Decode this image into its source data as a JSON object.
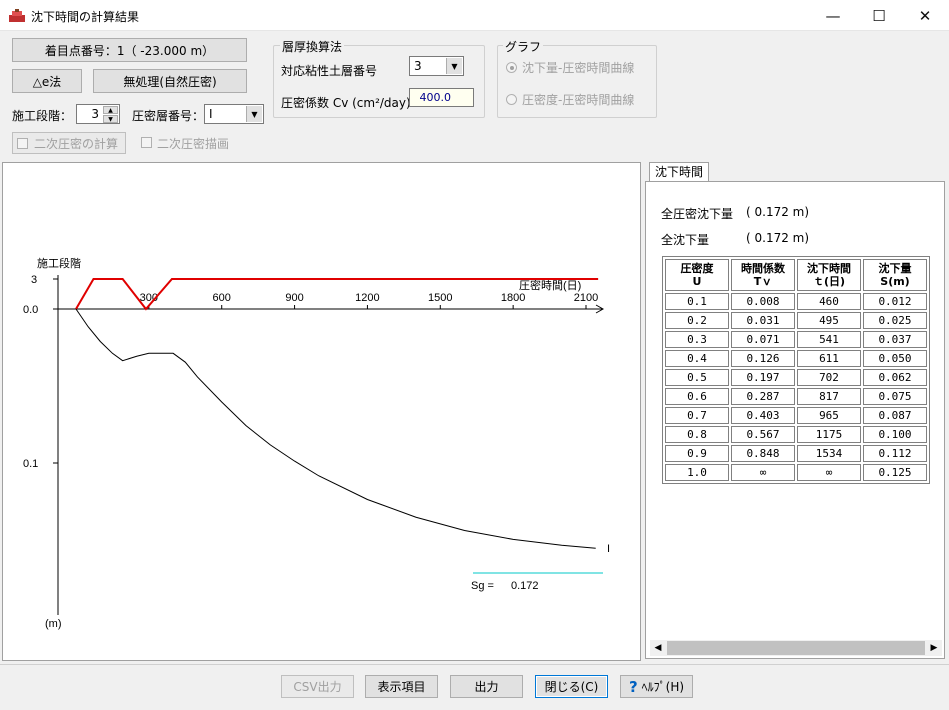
{
  "window": {
    "title": "沈下時間の計算結果",
    "minimize_glyph": "—",
    "maximize_glyph": "☐",
    "close_glyph": "✕"
  },
  "top_controls": {
    "point_button": "着目点番号：1（ -23.000 m）",
    "delta_e_button": "△e法",
    "no_treatment_button": "無処理(自然圧密)",
    "construction_stage_label": "施工段階：",
    "construction_stage_value": "3",
    "consolidation_layer_label": "圧密層番号：",
    "consolidation_layer_value": "I",
    "secondary_calc_button": "二次圧密の計算",
    "secondary_draw_label": "二次圧密描画"
  },
  "layer_group": {
    "title": "層厚換算法",
    "clay_layer_label": "対応粘性土層番号",
    "clay_layer_value": "3",
    "cv_label": "圧密係数 Cv (cm²/day)",
    "cv_value": "400.0"
  },
  "graph_group": {
    "title": "グラフ",
    "option1": "沈下量-圧密時間曲線",
    "option2": "圧密度-圧密時間曲線",
    "selected": "option1"
  },
  "graph": {
    "stage_axis_label": "施工段階",
    "stage_tick": "3",
    "x_axis_label": "圧密時間(日)",
    "x_ticks": [
      "300",
      "600",
      "900",
      "1200",
      "1500",
      "1800",
      "2100"
    ],
    "y_ticks": [
      "0.0",
      "0.1"
    ],
    "y_unit": "(m)",
    "curve_label": "I",
    "sg_label": "Sg =",
    "sg_value": "0.172",
    "stage_color": "#e00000",
    "curve_color": "#000000",
    "final_color": "#00c8c8"
  },
  "chart_data": {
    "type": "line",
    "title": "",
    "xlabel": "圧密時間(日)",
    "ylabel": "(m)",
    "xlim": [
      0,
      2150
    ],
    "ylim_settlement": [
      0,
      0.2
    ],
    "settlement_series": {
      "name": "I",
      "x": [
        0,
        50,
        100,
        150,
        192,
        250,
        300,
        350,
        400,
        450,
        500,
        600,
        700,
        800,
        900,
        1000,
        1200,
        1400,
        1600,
        1800,
        2000,
        2140
      ],
      "y": [
        0.0,
        0.012,
        0.022,
        0.03,
        0.035,
        0.032,
        0.03,
        0.03,
        0.03,
        0.036,
        0.046,
        0.063,
        0.079,
        0.092,
        0.103,
        0.113,
        0.129,
        0.141,
        0.15,
        0.156,
        0.16,
        0.162
      ]
    },
    "construction_stage_series": {
      "x": [
        0,
        72,
        192,
        288,
        395,
        2150
      ],
      "y": [
        0,
        1,
        1,
        0,
        1,
        1
      ],
      "x_detail": [
        0,
        72,
        192,
        288,
        395,
        2150
      ]
    },
    "final_settlement": 0.172
  },
  "tab": {
    "label": "沈下時間"
  },
  "summary": {
    "total_consolidation_label": "全圧密沈下量",
    "total_consolidation_value": "( 0.172 m)",
    "total_settlement_label": "全沈下量",
    "total_settlement_value": "( 0.172 m)"
  },
  "table": {
    "headers": [
      [
        "圧密度",
        "U"
      ],
      [
        "時間係数",
        "Tｖ"
      ],
      [
        "沈下時間",
        "ｔ(日)"
      ],
      [
        "沈下量",
        "S(m)"
      ]
    ],
    "rows": [
      [
        "0.1",
        "0.008",
        "460",
        "0.012"
      ],
      [
        "0.2",
        "0.031",
        "495",
        "0.025"
      ],
      [
        "0.3",
        "0.071",
        "541",
        "0.037"
      ],
      [
        "0.4",
        "0.126",
        "611",
        "0.050"
      ],
      [
        "0.5",
        "0.197",
        "702",
        "0.062"
      ],
      [
        "0.6",
        "0.287",
        "817",
        "0.075"
      ],
      [
        "0.7",
        "0.403",
        "965",
        "0.087"
      ],
      [
        "0.8",
        "0.567",
        "1175",
        "0.100"
      ],
      [
        "0.9",
        "0.848",
        "1534",
        "0.112"
      ],
      [
        "1.0",
        "∞",
        "∞",
        "0.125"
      ]
    ]
  },
  "bottom_buttons": {
    "csv": "CSV出力",
    "display_items": "表示項目",
    "output": "出力",
    "close": "閉じる(C)",
    "help": "ﾍﾙﾌﾟ(H)"
  }
}
